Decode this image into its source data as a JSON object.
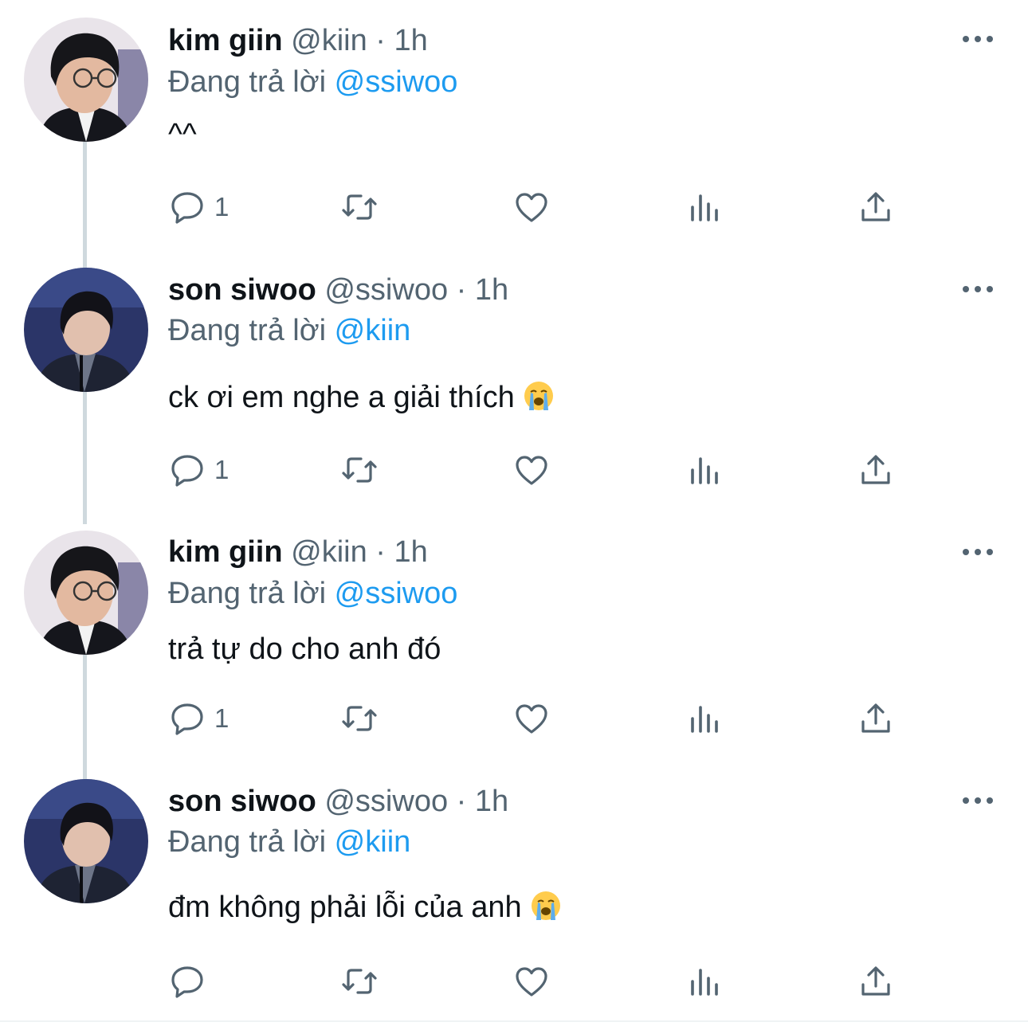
{
  "tweets": [
    {
      "name": "kim giin",
      "handle": "@kiin",
      "dot": "·",
      "time": "1h",
      "reply_prefix": "Đang trả lời",
      "reply_to": "@ssiwoo",
      "text": "^^",
      "avatar": "avatar-kiin",
      "reply_count": "1",
      "emoji": ""
    },
    {
      "name": "son siwoo",
      "handle": "@ssiwoo",
      "dot": "·",
      "time": "1h",
      "reply_prefix": "Đang trả lời",
      "reply_to": "@kiin",
      "text": "ck ơi em nghe a giải thích",
      "avatar": "avatar-ssiwoo",
      "reply_count": "1",
      "emoji": "loudly-crying-face"
    },
    {
      "name": "kim giin",
      "handle": "@kiin",
      "dot": "·",
      "time": "1h",
      "reply_prefix": "Đang trả lời",
      "reply_to": "@ssiwoo",
      "text": "trả tự do cho anh đó",
      "avatar": "avatar-kiin",
      "reply_count": "1",
      "emoji": ""
    },
    {
      "name": "son siwoo",
      "handle": "@ssiwoo",
      "dot": "·",
      "time": "1h",
      "reply_prefix": "Đang trả lời",
      "reply_to": "@kiin",
      "text": "đm không phải lỗi của anh",
      "avatar": "avatar-ssiwoo",
      "reply_count": "",
      "emoji": "loudly-crying-face"
    }
  ],
  "icons": {
    "reply": "speech-bubble-icon",
    "retweet": "retweet-icon",
    "like": "heart-icon",
    "views": "bar-chart-icon",
    "share": "share-upload-icon",
    "more": "more-dots-icon"
  },
  "colors": {
    "text": "#0f1419",
    "secondary": "#536471",
    "mention": "#1d9bf0",
    "thread_line": "#cfd9de"
  }
}
